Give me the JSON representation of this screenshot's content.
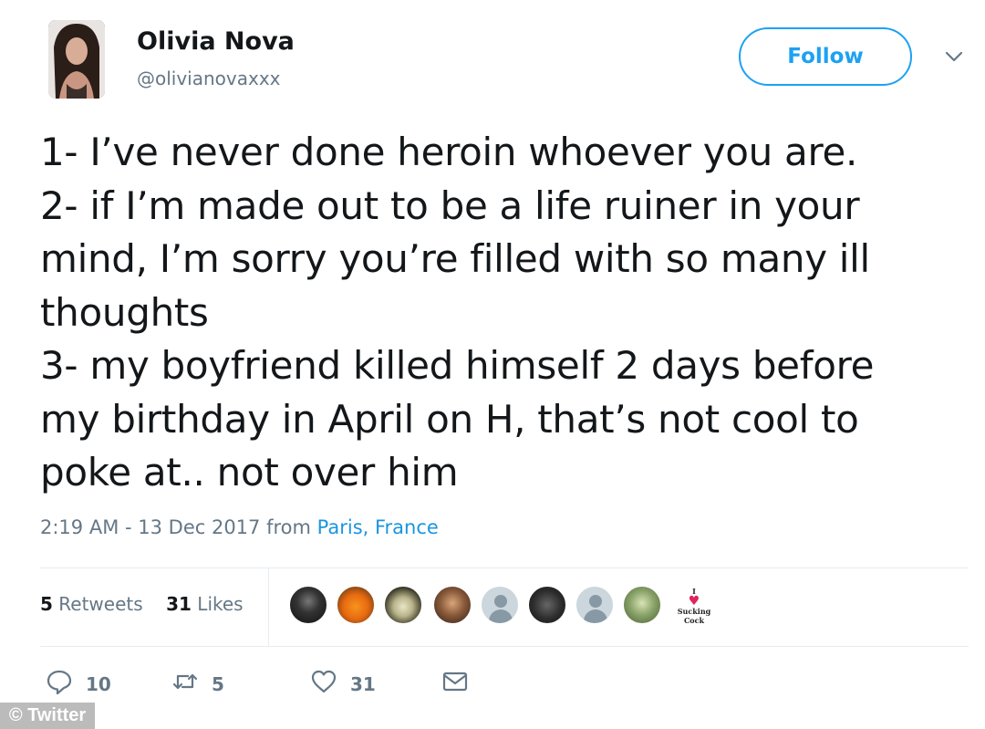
{
  "author": {
    "name": "Olivia Nova",
    "handle": "@olivianovaxxx"
  },
  "follow_label": "Follow",
  "tweet": {
    "lines": [
      "1- I’ve never done heroin whoever you are.",
      "2- if I’m made out to be a life ruiner in your",
      "mind, I’m sorry you’re filled with so many ill",
      "thoughts",
      "3- my boyfriend killed himself 2 days before",
      "my birthday in April on H, that’s not cool to",
      "poke at.. not over him"
    ],
    "timestamp": "2:19 AM - 13 Dec 2017 from",
    "location": "Paris, France"
  },
  "stats": {
    "retweets_count": "5",
    "retweets_label": "Retweets",
    "likes_count": "31",
    "likes_label": "Likes"
  },
  "liker_text": {
    "line1": "I",
    "line2": "Sucking",
    "line3": "Cock"
  },
  "actions": {
    "reply_count": "10",
    "retweet_count": "5",
    "like_count": "31"
  },
  "watermark": "© Twitter",
  "colors": {
    "accent": "#1da1f2",
    "secondary_text": "#657786",
    "primary_text": "#14171a"
  }
}
